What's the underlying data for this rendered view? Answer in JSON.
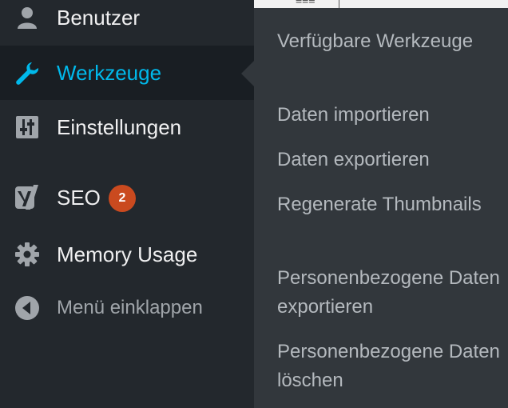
{
  "sidebar": {
    "items": [
      {
        "label": "Benutzer",
        "icon": "user-icon"
      },
      {
        "label": "Werkzeuge",
        "icon": "wrench-icon",
        "active": true
      },
      {
        "label": "Einstellungen",
        "icon": "settings-sliders-icon"
      },
      {
        "label": "SEO",
        "icon": "yoast-icon",
        "badge": "2"
      },
      {
        "label": "Memory Usage",
        "icon": "gear-icon"
      },
      {
        "label": "Menü einklappen",
        "icon": "collapse-arrow-icon"
      }
    ]
  },
  "submenu": {
    "items": [
      {
        "label": "Verfügbare Werkzeuge"
      },
      {
        "label": "Daten importieren"
      },
      {
        "label": "Daten exportieren"
      },
      {
        "label": "Regenerate Thumbnails"
      },
      {
        "label": "Personenbezogene Daten exportieren"
      },
      {
        "label": "Personenbezogene Daten löschen"
      }
    ]
  },
  "colors": {
    "sidebar_bg": "#23282d",
    "active_bg": "#191e23",
    "active_text": "#00b9eb",
    "submenu_bg": "#32373c",
    "badge_bg": "#ca4a1f"
  }
}
